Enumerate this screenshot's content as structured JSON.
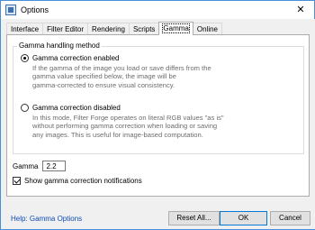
{
  "window": {
    "title": "Options",
    "close_glyph": "✕"
  },
  "tabs": [
    {
      "label": "Interface",
      "active": false
    },
    {
      "label": "Filter Editor",
      "active": false
    },
    {
      "label": "Rendering",
      "active": false
    },
    {
      "label": "Scripts",
      "active": false
    },
    {
      "label": "Gamma",
      "active": true
    },
    {
      "label": "Online",
      "active": false
    }
  ],
  "gamma_panel": {
    "group_title": "Gamma handling method",
    "option_enabled": {
      "label": "Gamma correction enabled",
      "checked": true,
      "description_lines": [
        "If the gamma of the image you load or save differs from the",
        "gamma value specified below, the image will be",
        "gamma-corrected to ensure visual consistency."
      ]
    },
    "option_disabled": {
      "label": "Gamma correction disabled",
      "checked": false,
      "description_lines": [
        "In this mode, Filter Forge operates on literal RGB values \"as is\"",
        "without performing gamma correction when loading or saving",
        "any images. This is useful for image-based computation."
      ]
    },
    "gamma_label": "Gamma",
    "gamma_value": "2.2",
    "notifications_label": "Show gamma correction notifications",
    "notifications_checked": true
  },
  "footer": {
    "help_link": "Help: Gamma Options",
    "reset_label": "Reset All...",
    "ok_label": "OK",
    "cancel_label": "Cancel"
  },
  "colors": {
    "link": "#0e4db3",
    "description": "#6d6d6d",
    "default_button_border": "#0078d7"
  },
  "icons": [
    "app-icon",
    "close-icon"
  ]
}
